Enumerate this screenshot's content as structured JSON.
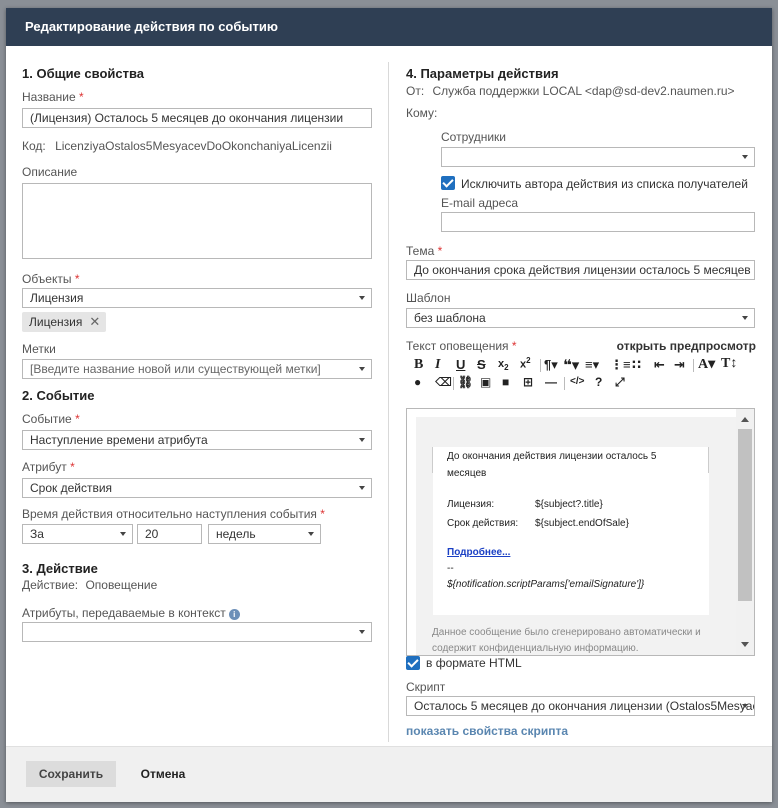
{
  "header": {
    "title": "Редактирование действия по событию"
  },
  "general": {
    "section_title": "1. Общие свойства",
    "name_label": "Название",
    "name_value": "(Лицензия) Осталось 5 месяцев до окончания лицензии",
    "code_label": "Код:",
    "code_value": "LicenziyaOstalos5MesyacevDoOkonchaniyaLicenzii",
    "description_label": "Описание",
    "objects_label": "Объекты",
    "objects_value": "Лицензия",
    "objects_tag": "Лицензия",
    "tags_label": "Метки",
    "tags_placeholder": "[Введите название новой или существующей метки]"
  },
  "event": {
    "section_title": "2. Событие",
    "event_label": "Событие",
    "event_value": "Наступление времени атрибута",
    "attribute_label": "Атрибут",
    "attribute_value": "Срок действия",
    "time_label": "Время действия относительно наступления события",
    "time_direction": "За",
    "time_amount": "20",
    "time_unit": "недель"
  },
  "action": {
    "section_title": "3. Действие",
    "action_label": "Действие:",
    "action_value": "Оповещение",
    "context_attrs_label": "Атрибуты, передаваемые в контекст"
  },
  "params": {
    "section_title": "4. Параметры действия",
    "from_label": "От:",
    "from_value": "Служба поддержки LOCAL <dap@sd-dev2.naumen.ru>",
    "to_label": "Кому:",
    "employees_label": "Сотрудники",
    "exclude_author_label": "Исключить автора действия из списка получателей",
    "email_label": "E-mail адреса",
    "subject_label": "Тема",
    "subject_value": "До окончания срока действия лицензии осталось 5 месяцев",
    "template_label": "Шаблон",
    "template_value": "без шаблона",
    "text_label": "Текст оповещения",
    "preview_link": "открыть предпросмотр",
    "html_format_label": "в формате HTML",
    "script_label": "Скрипт",
    "script_value": "Осталось 5 месяцев до окончания лицензии (Ostalos5Mesyacev",
    "show_script_link": "показать свойства скрипта"
  },
  "editor": {
    "heading_line1": "До окончания действия лицензии осталось 5",
    "heading_line2": "месяцев",
    "row1_label": "Лицензия:",
    "row1_value": "${subject?.title}",
    "row2_label": "Срок действия:",
    "row2_value": "${subject.endOfSale}",
    "more_link": "Подробнее...",
    "separator": "--",
    "signature": "${notification.scriptParams['emailSignature']}",
    "footer_line1": "Данное сообщение было сгенерировано автоматически и",
    "footer_line2": "содержит конфиденциальную информацию."
  },
  "footer": {
    "save_label": "Сохранить",
    "cancel_label": "Отмена"
  },
  "colors": {
    "header_bg": "#2f3f54",
    "checkbox": "#1f6fbf",
    "link": "#5a86b0",
    "required": "#dd3333"
  }
}
